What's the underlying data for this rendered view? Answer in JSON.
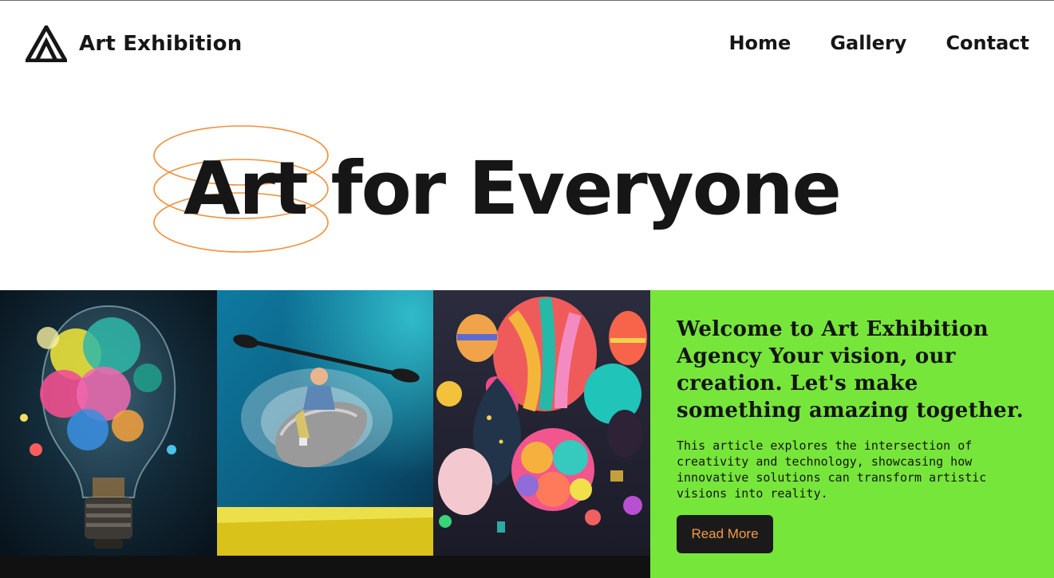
{
  "brand": {
    "name": "Art Exhibition",
    "logo_icon": "triangle-logo-icon"
  },
  "nav": {
    "items": [
      {
        "label": "Home"
      },
      {
        "label": "Gallery"
      },
      {
        "label": "Contact"
      }
    ]
  },
  "hero": {
    "title": "Art for Everyone",
    "accent_color": "#f0913d"
  },
  "gallery": {
    "tiles": [
      {
        "subject": "exploding paint lightbulb"
      },
      {
        "subject": "kayaker splashing"
      },
      {
        "subject": "hot air balloons"
      }
    ]
  },
  "panel": {
    "heading": "Welcome to Art Exhibition Agency Your vision, our creation. Let's make something amazing together.",
    "body": "This article explores the intersection of creativity and technology, showcasing how innovative solutions can transform artistic visions into reality.",
    "cta_label": "Read More",
    "background_color": "#77e63b",
    "cta_text_color": "#f39a4a"
  }
}
